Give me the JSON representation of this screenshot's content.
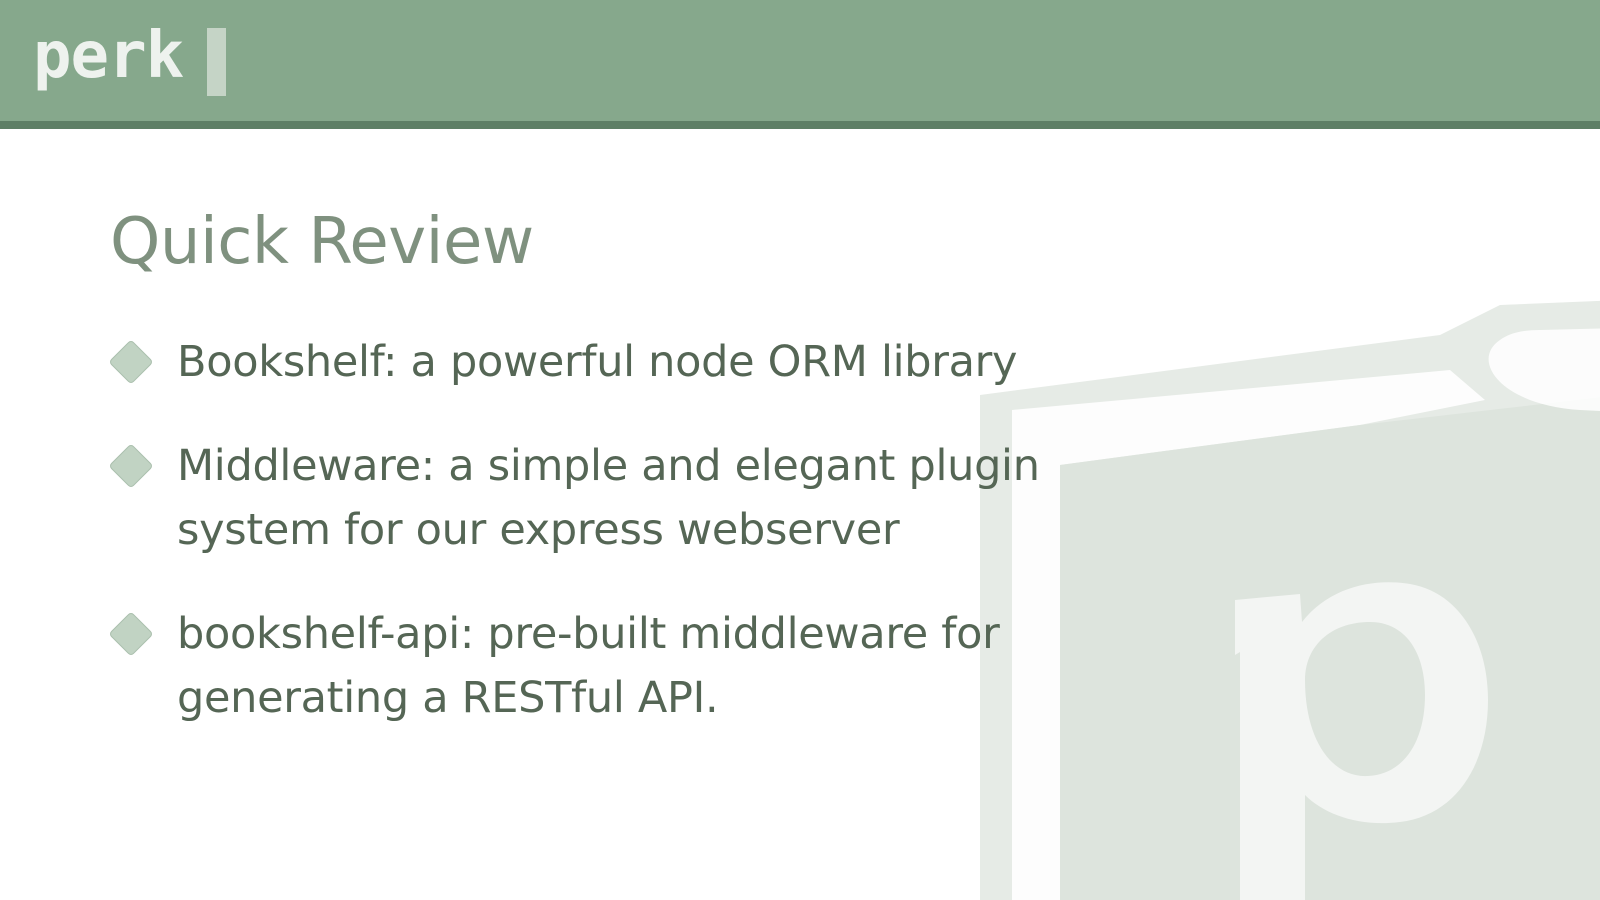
{
  "header": {
    "logo_text": "perk",
    "brand_color": "#86a88c",
    "border_color": "#5e7f66"
  },
  "watermark": {
    "letter": "p",
    "icon": "book-logo-icon"
  },
  "slide": {
    "title": "Quick Review",
    "bullets": [
      {
        "text": "Bookshelf: a powerful node ORM library",
        "icon": "diamond-bullet-icon"
      },
      {
        "text": "Middleware: a simple and elegant plugin system for our express webserver",
        "icon": "diamond-bullet-icon"
      },
      {
        "text": "bookshelf-api: pre-built middleware for generating a RESTful API.",
        "icon": "diamond-bullet-icon"
      }
    ]
  }
}
